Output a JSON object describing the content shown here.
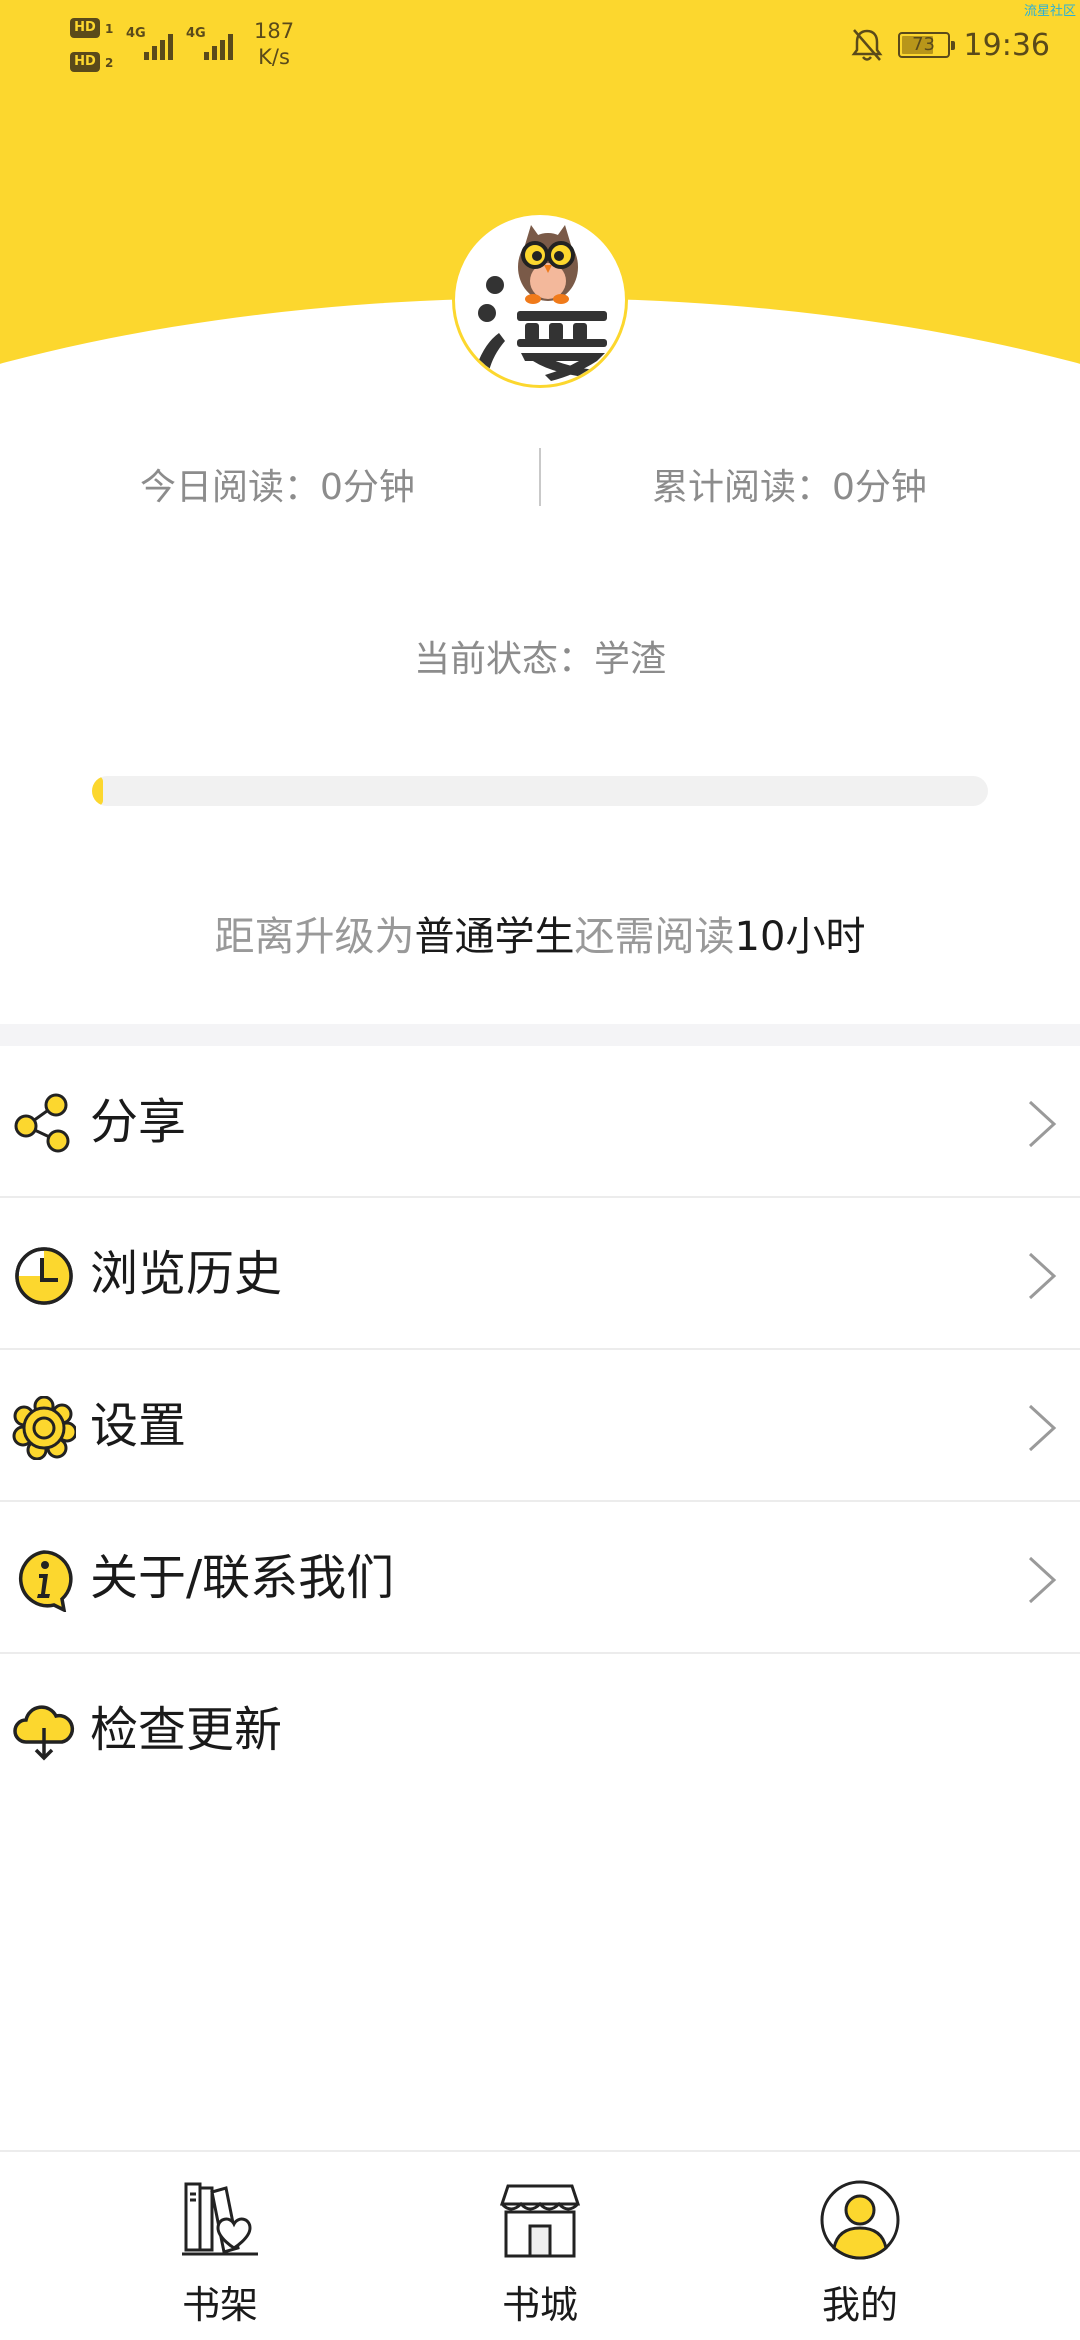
{
  "status_bar": {
    "sim1": "HD",
    "sim1_num": "1",
    "sim2": "HD",
    "sim2_num": "2",
    "network1": "4G",
    "network2": "4G",
    "speed_value": "187",
    "speed_unit": "K/s",
    "battery": "73",
    "time": "19:36",
    "watermark": "流星社区"
  },
  "profile": {
    "avatar_icon": "manga-owl-logo",
    "today_reading": "今日阅读：0分钟",
    "total_reading": "累计阅读：0分钟",
    "status": "当前状态：学渣",
    "progress": 0.01,
    "upgrade": {
      "prefix": "距离升级为",
      "level": "普通学生",
      "middle": "还需阅读",
      "remaining": "10小时"
    }
  },
  "menu": [
    {
      "label": "分享",
      "icon": "share-icon"
    },
    {
      "label": "浏览历史",
      "icon": "clock-icon"
    },
    {
      "label": "设置",
      "icon": "gear-icon"
    },
    {
      "label": "关于/联系我们",
      "icon": "info-icon"
    },
    {
      "label": "检查更新",
      "icon": "cloud-download-icon"
    }
  ],
  "bottom_nav": [
    {
      "label": "书架",
      "icon": "bookshelf-icon"
    },
    {
      "label": "书城",
      "icon": "bookstore-icon"
    },
    {
      "label": "我的",
      "icon": "profile-icon"
    }
  ],
  "colors": {
    "accent": "#FCD72E",
    "text_dark": "#1a1a1a",
    "text_gray": "#8c8c8c"
  }
}
